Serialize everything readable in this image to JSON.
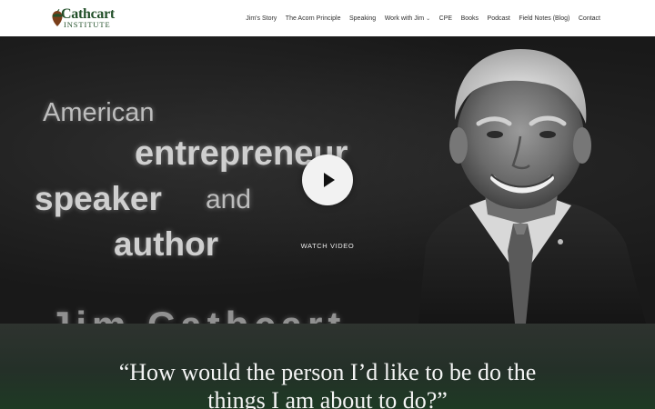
{
  "brand": {
    "name": "Cathcart",
    "subtitle": "INSTITUTE",
    "color": "#23502a"
  },
  "nav": {
    "items": [
      {
        "label": "Jim's Story"
      },
      {
        "label": "The Acorn Principle"
      },
      {
        "label": "Speaking"
      },
      {
        "label": "Work with Jim",
        "dropdown": true
      },
      {
        "label": "CPE"
      },
      {
        "label": "Books"
      },
      {
        "label": "Podcast"
      },
      {
        "label": "Field Notes (Blog)"
      },
      {
        "label": "Contact"
      }
    ]
  },
  "hero": {
    "words": {
      "american": "American",
      "entrepreneur": "entrepreneur",
      "speaker": "speaker",
      "and": "and",
      "author": "author",
      "partial": "Jim Cathcart"
    },
    "watch_label": "WATCH VIDEO",
    "play_icon": "play-icon"
  },
  "quote": {
    "text": "“How would the person I’d like to be do the things I am about to do?”"
  }
}
